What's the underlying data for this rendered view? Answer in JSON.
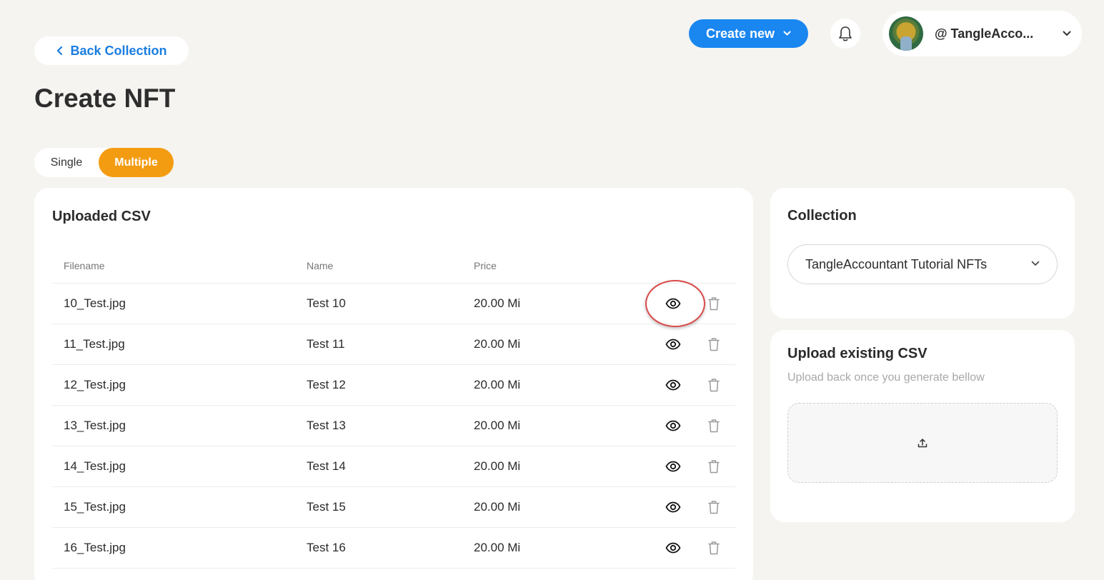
{
  "header": {
    "back_label": "Back Collection",
    "create_new_label": "Create new",
    "account_handle": "@ TangleAcco..."
  },
  "page": {
    "title": "Create NFT",
    "mode_options": [
      "Single",
      "Multiple"
    ],
    "active_mode": "Multiple"
  },
  "csv": {
    "title": "Uploaded CSV",
    "columns": [
      "Filename",
      "Name",
      "Price"
    ],
    "rows": [
      {
        "filename": "10_Test.jpg",
        "name": "Test 10",
        "price": "20.00 Mi"
      },
      {
        "filename": "11_Test.jpg",
        "name": "Test 11",
        "price": "20.00 Mi"
      },
      {
        "filename": "12_Test.jpg",
        "name": "Test 12",
        "price": "20.00 Mi"
      },
      {
        "filename": "13_Test.jpg",
        "name": "Test 13",
        "price": "20.00 Mi"
      },
      {
        "filename": "14_Test.jpg",
        "name": "Test 14",
        "price": "20.00 Mi"
      },
      {
        "filename": "15_Test.jpg",
        "name": "Test 15",
        "price": "20.00 Mi"
      },
      {
        "filename": "16_Test.jpg",
        "name": "Test 16",
        "price": "20.00 Mi"
      }
    ],
    "row_actions": [
      "eye-icon",
      "trash-icon"
    ]
  },
  "collection": {
    "title": "Collection",
    "selected": "TangleAccountant Tutorial NFTs"
  },
  "upload": {
    "title": "Upload existing CSV",
    "subtitle": "Upload back once you generate bellow",
    "icon": "upload-icon"
  },
  "colors": {
    "background": "#f5f4f0",
    "primary_blue": "#1a86f0",
    "link_blue": "#1a7de0",
    "active_orange": "#f39c12",
    "highlight_red": "#d94a4a"
  }
}
